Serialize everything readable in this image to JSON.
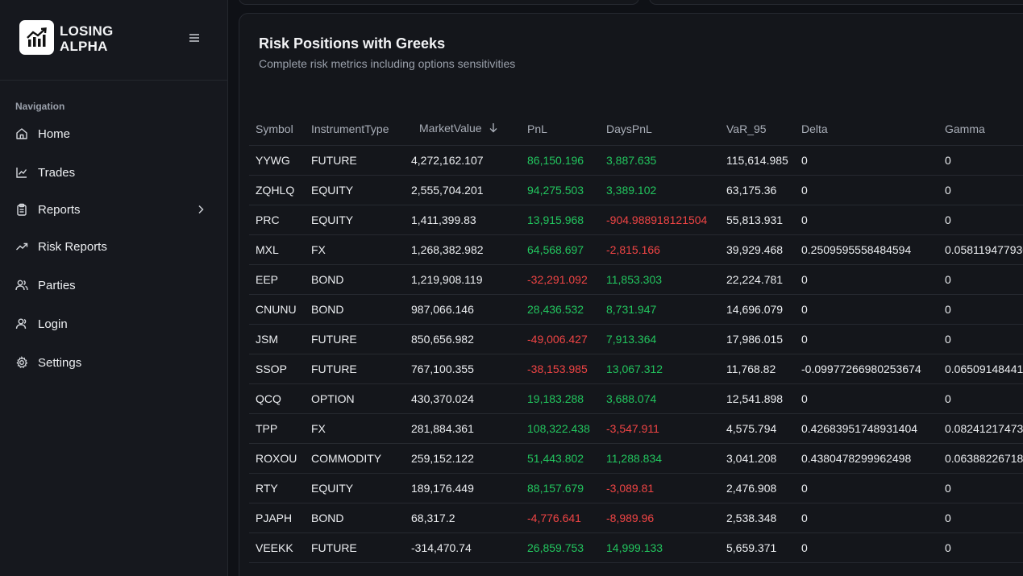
{
  "brand": {
    "line1": "LOSING",
    "line2": "ALPHA"
  },
  "nav": {
    "heading": "Navigation",
    "items": [
      {
        "label": "Home",
        "icon": "home-icon"
      },
      {
        "label": "Trades",
        "icon": "line-chart-icon"
      },
      {
        "label": "Reports",
        "icon": "clipboard-icon"
      },
      {
        "label": "Risk Reports",
        "icon": "trending-up-icon"
      },
      {
        "label": "Parties",
        "icon": "users-icon"
      },
      {
        "label": "Login",
        "icon": "user-icon"
      },
      {
        "label": "Settings",
        "icon": "gear-icon"
      }
    ]
  },
  "card": {
    "title": "Risk Positions with Greeks",
    "subtitle": "Complete risk metrics including options sensitivities"
  },
  "table": {
    "columns": [
      "Symbol",
      "InstrumentType",
      "MarketValue",
      "PnL",
      "DaysPnL",
      "VaR_95",
      "Delta",
      "Gamma"
    ],
    "rows": [
      [
        "YYWG",
        "FUTURE",
        "4,272,162.107",
        "86,150.196",
        "3,887.635",
        "115,614.985",
        "0",
        "0"
      ],
      [
        "ZQHLQ",
        "EQUITY",
        "2,555,704.201",
        "94,275.503",
        "3,389.102",
        "63,175.36",
        "0",
        "0"
      ],
      [
        "PRC",
        "EQUITY",
        "1,411,399.83",
        "13,915.968",
        "-904.988918121504",
        "55,813.931",
        "0",
        "0"
      ],
      [
        "MXL",
        "FX",
        "1,268,382.982",
        "64,568.697",
        "-2,815.166",
        "39,929.468",
        "0.2509595558484594",
        "0.058119477930"
      ],
      [
        "EEP",
        "BOND",
        "1,219,908.119",
        "-32,291.092",
        "11,853.303",
        "22,224.781",
        "0",
        "0"
      ],
      [
        "CNUNU",
        "BOND",
        "987,066.146",
        "28,436.532",
        "8,731.947",
        "14,696.079",
        "0",
        "0"
      ],
      [
        "JSM",
        "FUTURE",
        "850,656.982",
        "-49,006.427",
        "7,913.364",
        "17,986.015",
        "0",
        "0"
      ],
      [
        "SSOP",
        "FUTURE",
        "767,100.355",
        "-38,153.985",
        "13,067.312",
        "11,768.82",
        "-0.09977266980253674",
        "0.065091484410"
      ],
      [
        "QCQ",
        "OPTION",
        "430,370.024",
        "19,183.288",
        "3,688.074",
        "12,541.898",
        "0",
        "0"
      ],
      [
        "TPP",
        "FX",
        "281,884.361",
        "108,322.438",
        "-3,547.911",
        "4,575.794",
        "0.42683951748931404",
        "0.082412174730"
      ],
      [
        "ROXOU",
        "COMMODITY",
        "259,152.122",
        "51,443.802",
        "11,288.834",
        "3,041.208",
        "0.4380478299962498",
        "0.063882267180"
      ],
      [
        "RTY",
        "EQUITY",
        "189,176.449",
        "88,157.679",
        "-3,089.81",
        "2,476.908",
        "0",
        "0"
      ],
      [
        "PJAPH",
        "BOND",
        "68,317.2",
        "-4,776.641",
        "-8,989.96",
        "2,538.348",
        "0",
        "0"
      ],
      [
        "VEEKK",
        "FUTURE",
        "-314,470.74",
        "26,859.753",
        "14,999.133",
        "5,659.371",
        "0",
        "0"
      ]
    ]
  },
  "colors": {
    "positive": "#22c55e",
    "negative": "#ef4444",
    "background": "#0f1116"
  }
}
